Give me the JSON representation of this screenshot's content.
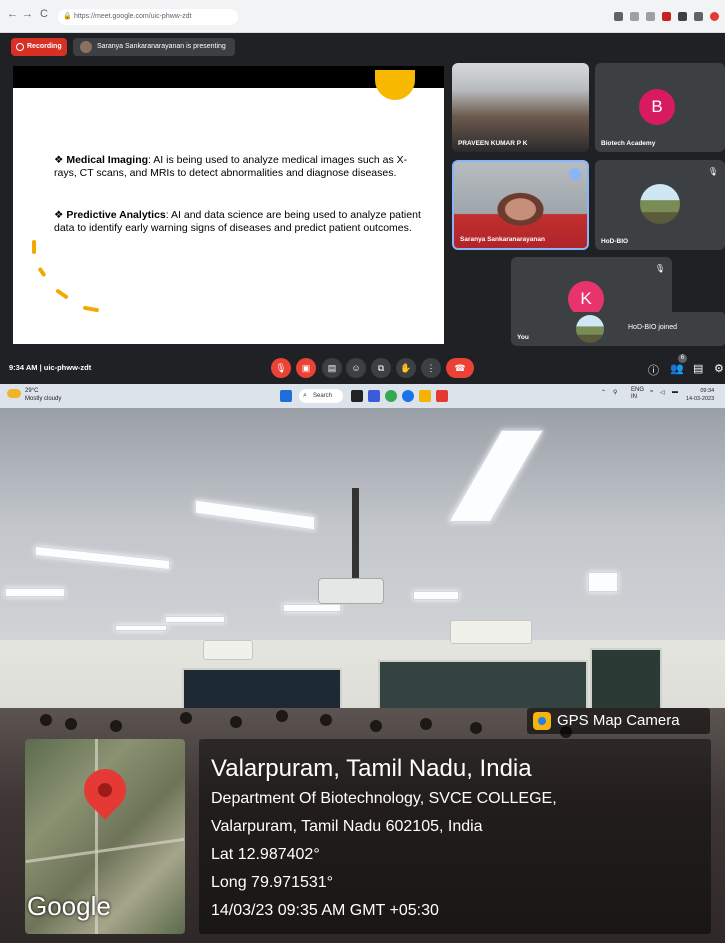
{
  "browser": {
    "url": "https://meet.google.com/uic-phww-zdt",
    "nav": [
      "←",
      "→",
      "C"
    ]
  },
  "meet": {
    "recording_label": "Recording",
    "presenting_label": "Saranya Sankaranarayanan is presenting",
    "slide": {
      "bullet1_title": "Medical Imaging",
      "bullet1_text": ": AI is being used to analyze medical images such as X-rays, CT scans, and MRIs to detect abnormalities and diagnose diseases.",
      "bullet2_title": "Predictive Analytics",
      "bullet2_text": ": AI and data science are being used to analyze patient data to identify early warning signs of diseases and predict patient outcomes."
    },
    "tiles": [
      {
        "name": "PRAVEEN KUMAR P K",
        "kind": "video"
      },
      {
        "name": "Biotech Academy",
        "letter": "B",
        "color": "#d81b60"
      },
      {
        "name": "Saranya Sankaranarayanan",
        "kind": "video"
      },
      {
        "name": "HoD-BIO",
        "kind": "avatar"
      },
      {
        "name": "You",
        "letter": "K",
        "color": "#e8336d"
      }
    ],
    "toast": "HoD-BIO joined",
    "time_code": "9:34 AM  |  uic-phww-zdt",
    "people_count": "6"
  },
  "taskbar": {
    "temp": "29°C",
    "weather": "Mostly cloudy",
    "search": "Search",
    "lang_top": "ENG",
    "lang_bottom": "IN",
    "time": "09:34",
    "date": "14-03-2023"
  },
  "geotag": {
    "camera_label": "GPS Map Camera",
    "title": "Valarpuram, Tamil Nadu, India",
    "address1": "Department Of Biotechnology, SVCE COLLEGE,",
    "address2": "Valarpuram, Tamil Nadu 602105, India",
    "lat": "Lat 12.987402°",
    "long": "Long 79.971531°",
    "datetime": "14/03/23 09:35 AM GMT +05:30",
    "map_brand": "Google"
  },
  "colors": {
    "meet_bg": "#202124",
    "tile_bg": "#3c4043",
    "record_red": "#d93025",
    "slide_accent": "#f2a900"
  }
}
